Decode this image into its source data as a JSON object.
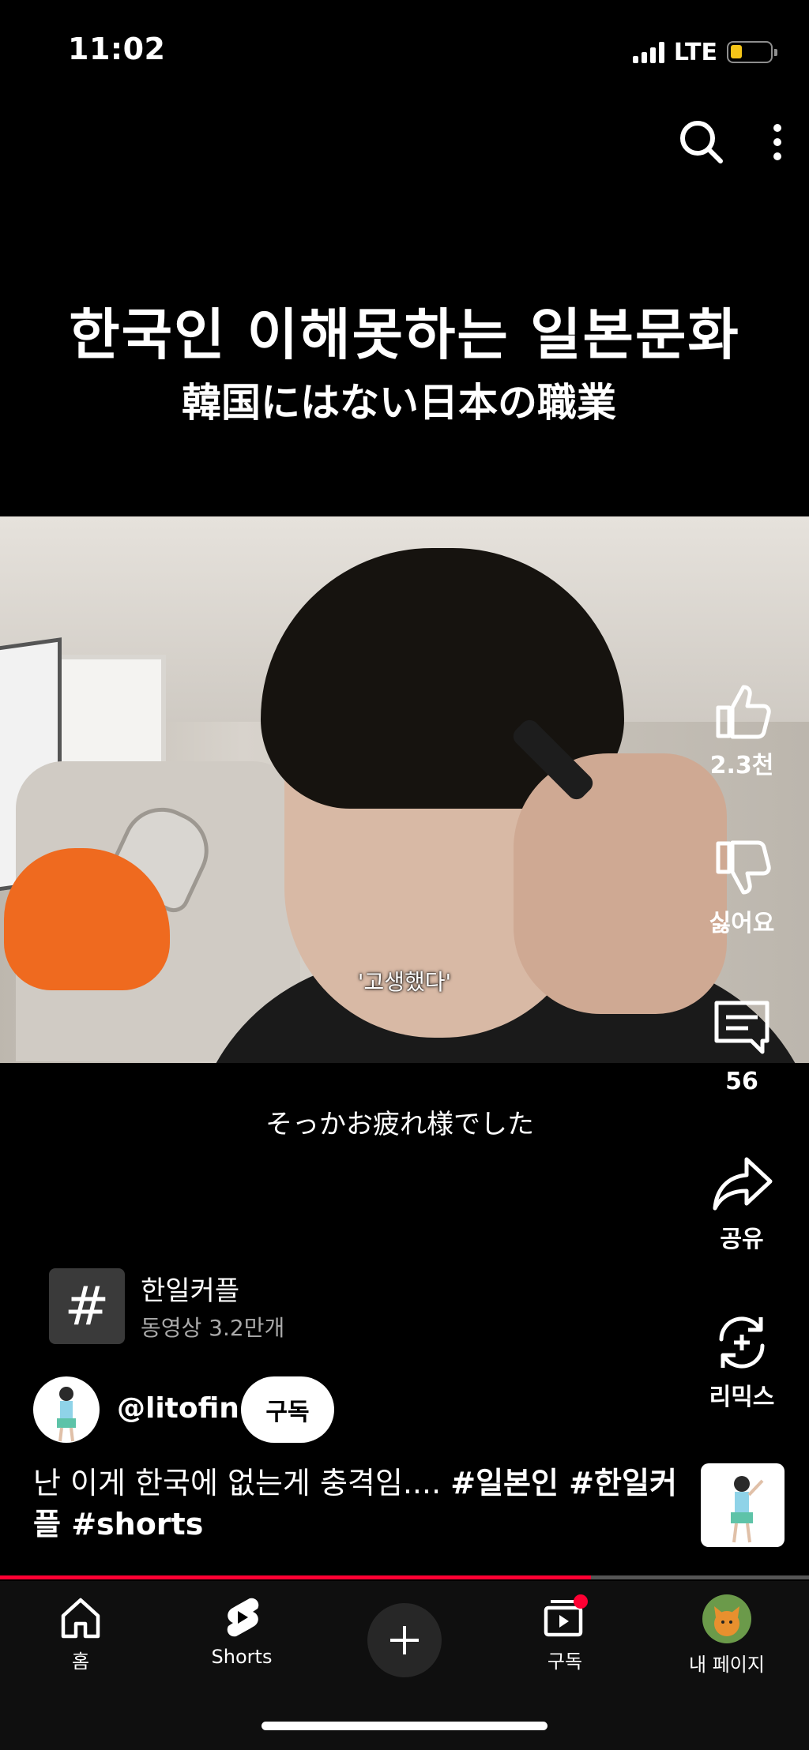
{
  "status_bar": {
    "time": "11:02",
    "network": "LTE",
    "battery_level": 0.25
  },
  "video": {
    "title_ko": "한국인 이해못하는 일본문화",
    "title_jp": "韓国にはない日本の職業",
    "subtitle_in_frame": "'고생했다'",
    "caption_jp": "そっかお疲れ様でした",
    "progress": 0.73
  },
  "rail": {
    "like_label": "2.3천",
    "dislike_label": "싫어요",
    "comments_label": "56",
    "share_label": "공유",
    "remix_label": "리믹스"
  },
  "hashtag": {
    "title": "한일커플",
    "count": "동영상 3.2만개"
  },
  "channel": {
    "handle": "@litofin",
    "subscribe_label": "구독"
  },
  "description": {
    "text": "난 이게 한국에 없는게 충격임.... ",
    "tags": "#일본인 #한일커플 #shorts"
  },
  "nav": {
    "home": "홈",
    "shorts": "Shorts",
    "subscriptions": "구독",
    "my_page": "내 페이지"
  },
  "colors": {
    "accent": "#ff0033",
    "battery": "#f5c518",
    "background": "#000000"
  }
}
